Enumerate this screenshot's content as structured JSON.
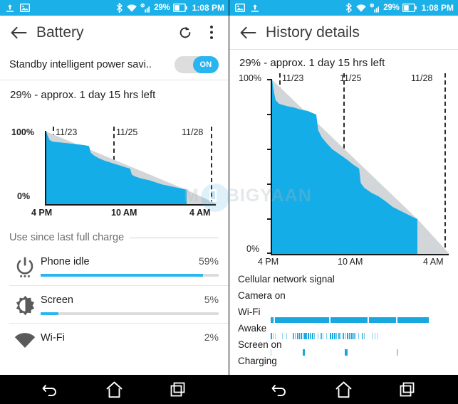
{
  "watermark": "BIGYAAN",
  "left": {
    "statusbar": {
      "icons_left": [
        "upload-icon",
        "image-icon"
      ],
      "icons_right": [
        "bluetooth-icon",
        "wifi-icon",
        "signal-icon"
      ],
      "battery_percent": "29%",
      "time": "1:08 PM"
    },
    "toolbar": {
      "back_label": "back",
      "title": "Battery",
      "refresh_label": "refresh",
      "overflow_label": "more options"
    },
    "toggle": {
      "label": "Standby intelligent power savi..",
      "state": "ON"
    },
    "chart_title": "29% - approx. 1 day 15 hrs left",
    "section_header": "Use since last full charge",
    "usage": [
      {
        "icon": "power-icon",
        "name": "Phone idle",
        "percent": "59%",
        "value": 59
      },
      {
        "icon": "brightness-icon",
        "name": "Screen",
        "percent": "5%",
        "value": 5
      },
      {
        "icon": "wifi-filled-icon",
        "name": "Wi-Fi",
        "percent": "2%",
        "value": 2
      }
    ],
    "nav": [
      "back-nav-icon",
      "home-nav-icon",
      "recents-nav-icon"
    ]
  },
  "right": {
    "statusbar": {
      "icons_left": [
        "image-icon",
        "upload-icon"
      ],
      "icons_right": [
        "bluetooth-icon",
        "wifi-icon",
        "signal-icon"
      ],
      "battery_percent": "29%",
      "time": "1:08 PM"
    },
    "toolbar": {
      "back_label": "back",
      "title": "History details"
    },
    "chart_title": "29% - approx. 1 day 15 hrs left",
    "history_rows": [
      {
        "label": "Cellular network signal",
        "type": "empty"
      },
      {
        "label": "Camera on",
        "type": "empty"
      },
      {
        "label": "Wi-Fi",
        "type": "solid"
      },
      {
        "label": "Awake",
        "type": "dense-ticks"
      },
      {
        "label": "Screen on",
        "type": "sparse-ticks"
      },
      {
        "label": "Charging",
        "type": "empty"
      }
    ],
    "nav": [
      "back-nav-icon",
      "home-nav-icon",
      "recents-nav-icon"
    ]
  },
  "colors": {
    "accent_blue": "#14ade8",
    "statusbar_blue": "#1bb0e8",
    "toggle_blue": "#29b6f0",
    "chart_remaining_gray": "#d3d6d8",
    "axis_black": "#1a1a1a"
  },
  "chart_data": [
    {
      "id": "battery-history-left",
      "type": "area",
      "title": "29% - approx. 1 day 15 hrs left",
      "xlabel": "",
      "ylabel": "",
      "ylim": [
        0,
        100
      ],
      "ytick_labels": [
        "100%",
        "0%"
      ],
      "xtick_labels": [
        "4 PM",
        "10 AM",
        "4 AM"
      ],
      "xtick_positions_pct": [
        0,
        50,
        94
      ],
      "date_markers": [
        "11/23",
        "11/25",
        "11/28"
      ],
      "date_marker_positions_pct": [
        11.5,
        50.5,
        94
      ],
      "series": [
        {
          "name": "Battery level",
          "color": "#14ade8",
          "x_pct": [
            0,
            1,
            2,
            4,
            8,
            12,
            16,
            20,
            23,
            25,
            26,
            28,
            31,
            34,
            38,
            42,
            46,
            49,
            50,
            50.5,
            52,
            56,
            60,
            64,
            68,
            72,
            76,
            80,
            82
          ],
          "y_pct": [
            100,
            93,
            88,
            86,
            85,
            84,
            83,
            82,
            81,
            80,
            71,
            67,
            63,
            60,
            57,
            54,
            51,
            49,
            41,
            40,
            38,
            35,
            33,
            30,
            27,
            25,
            23,
            21,
            20
          ]
        },
        {
          "name": "Projected remaining",
          "color": "#d3d6d8",
          "x_pct": [
            82,
            100
          ],
          "y_pct": [
            20,
            0
          ]
        }
      ]
    },
    {
      "id": "battery-history-right",
      "type": "area",
      "title": "29% - approx. 1 day 15 hrs left",
      "xlabel": "",
      "ylabel": "",
      "ylim": [
        0,
        100
      ],
      "ytick_labels": [
        "100%",
        "0%"
      ],
      "xtick_labels": [
        "4 PM",
        "10 AM",
        "4 AM"
      ],
      "xtick_positions_pct": [
        0,
        50,
        94
      ],
      "date_markers": [
        "11/23",
        "11/25",
        "11/28"
      ],
      "date_marker_positions_pct": [
        11.5,
        50.5,
        94
      ],
      "series": [
        {
          "name": "Battery level",
          "color": "#14ade8",
          "x_pct": [
            0,
            1,
            2,
            4,
            8,
            12,
            16,
            20,
            23,
            25,
            26,
            28,
            31,
            34,
            38,
            42,
            46,
            49,
            50,
            50.5,
            52,
            56,
            60,
            64,
            68,
            72,
            76,
            80,
            82
          ],
          "y_pct": [
            100,
            93,
            88,
            86,
            85,
            84,
            83,
            82,
            81,
            80,
            71,
            67,
            63,
            60,
            57,
            54,
            51,
            49,
            41,
            40,
            38,
            35,
            33,
            30,
            27,
            25,
            23,
            21,
            20
          ]
        },
        {
          "name": "Projected remaining",
          "color": "#d3d6d8",
          "x_pct": [
            82,
            100
          ],
          "y_pct": [
            20,
            0
          ]
        }
      ]
    }
  ]
}
